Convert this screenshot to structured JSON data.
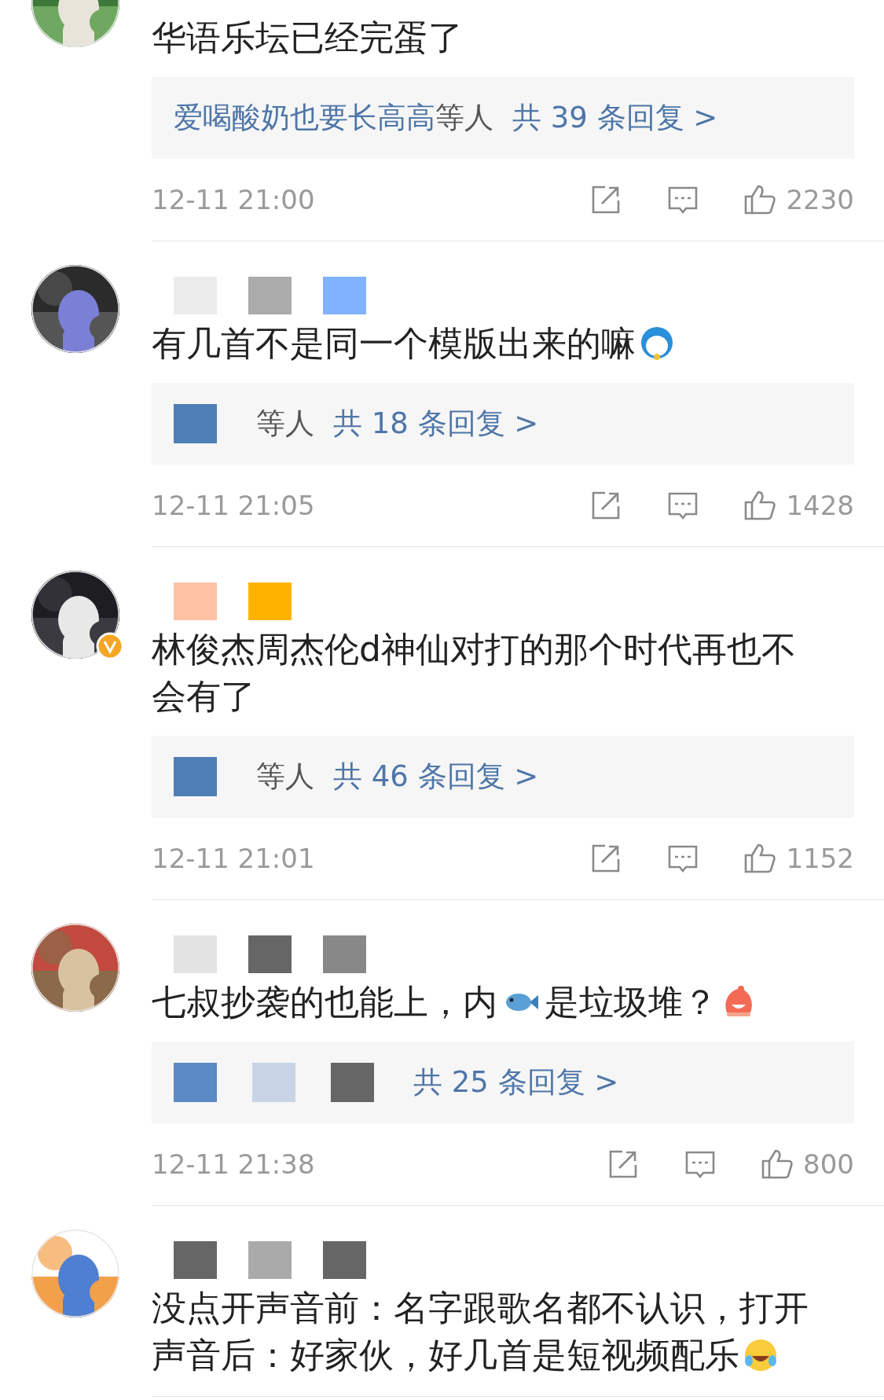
{
  "comments": [
    {
      "avatar": {
        "kind": "picture"
      },
      "verified": false,
      "segments": [
        {
          "kind": "text",
          "text": "华语乐坛已经完蛋了"
        }
      ],
      "replies": {
        "names": "爱喝酸奶也要长高高",
        "suffix": "等人",
        "count": "共 39 条回复 >"
      },
      "time": "12-11 21:00",
      "likes": "2230"
    },
    {
      "avatar": {
        "kind": "picture"
      },
      "verified": false,
      "name_blocks": [
        {
          "color": "#ececec"
        },
        {
          "color": "#ababab"
        },
        {
          "color": "#80b2ff"
        }
      ],
      "segments": [
        {
          "kind": "text",
          "text": "有几首不是同一个模版出来的嘛"
        },
        {
          "kind": "sticker"
        }
      ],
      "replies": {
        "name_blocks": [
          {
            "color": "#4f7fb6"
          }
        ],
        "suffix": "等人",
        "count": "共 18 条回复 >"
      },
      "time": "12-11 21:05",
      "likes": "1428"
    },
    {
      "avatar": {
        "kind": "picture"
      },
      "verified": true,
      "name_blocks": [
        {
          "color": "#ffc2a5"
        },
        {
          "color": "#ffb300"
        }
      ],
      "segments": [
        {
          "kind": "text",
          "text": "林俊杰周杰伦d神仙对打的那个时代再也不会有了"
        }
      ],
      "replies": {
        "name_blocks": [
          {
            "color": "#4f7fb6"
          }
        ],
        "suffix": "等人",
        "count": "共 46 条回复 >"
      },
      "time": "12-11 21:01",
      "likes": "1152"
    },
    {
      "avatar": {
        "kind": "picture"
      },
      "verified": false,
      "name_blocks": [
        {
          "color": "#e3e3e3"
        },
        {
          "color": "#666666"
        },
        {
          "color": "#888888"
        }
      ],
      "segments": [
        {
          "kind": "text",
          "text": "七叔抄袭的也能上，内"
        },
        {
          "kind": "fish"
        },
        {
          "kind": "text",
          "text": "是垃圾堆？"
        },
        {
          "kind": "blob"
        }
      ],
      "replies": {
        "name_blocks": [
          {
            "color": "#5b8ac4"
          },
          {
            "color": "#c8d4e6"
          },
          {
            "color": "#666666"
          }
        ],
        "count": "共 25 条回复 >"
      },
      "time": "12-11 21:38",
      "likes": "800"
    },
    {
      "avatar": {
        "kind": "picture"
      },
      "verified": false,
      "name_blocks": [
        {
          "color": "#666666"
        },
        {
          "color": "#aaaaaa"
        },
        {
          "color": "#666666"
        }
      ],
      "segments": [
        {
          "kind": "text",
          "text": "没点开声音前：名字跟歌名都不认识，打开"
        },
        {
          "kind": "text",
          "text": "声音后：好家伙，好几首是短视频配乐"
        },
        {
          "kind": "laugh"
        }
      ]
    }
  ]
}
